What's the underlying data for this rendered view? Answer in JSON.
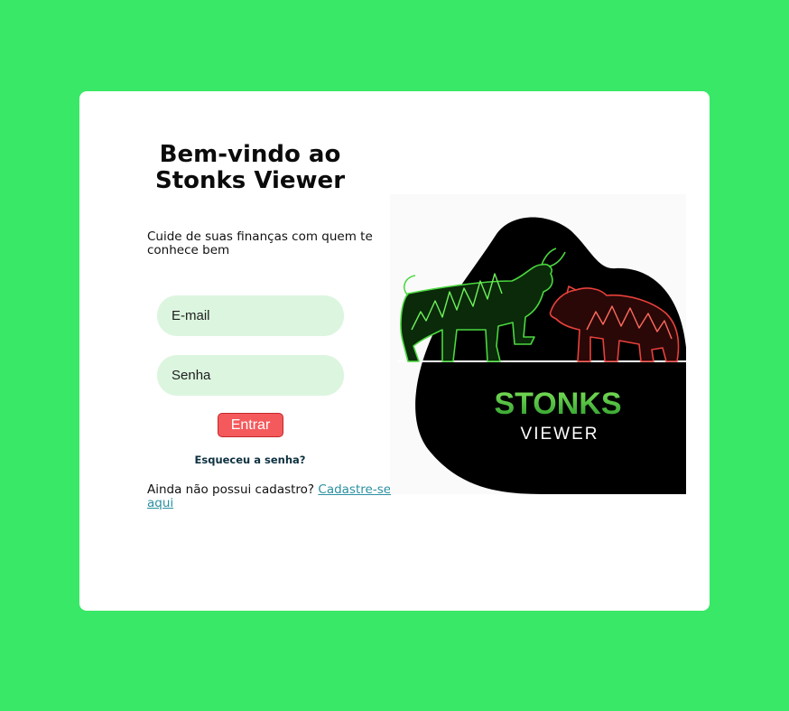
{
  "login": {
    "title_line1": "Bem-vindo ao",
    "title_line2": "Stonks Viewer",
    "subtitle": "Cuide de suas finanças com quem te conhece bem",
    "email_placeholder": "E-mail",
    "password_placeholder": "Senha",
    "submit_label": "Entrar",
    "forgot_label": "Esqueceu a senha?",
    "signup_text": "Ainda não possui cadastro? ",
    "signup_link": "Cadastre-se aqui"
  },
  "logo": {
    "word1": "STONKS",
    "word2": "VIEWER"
  },
  "colors": {
    "background": "#38e866",
    "card": "#ffffff",
    "input_fill": "#dcf5df",
    "button": "#f45a5c",
    "link": "#2a8fa2",
    "bull": "#4bd83f",
    "bear": "#e8413b"
  }
}
